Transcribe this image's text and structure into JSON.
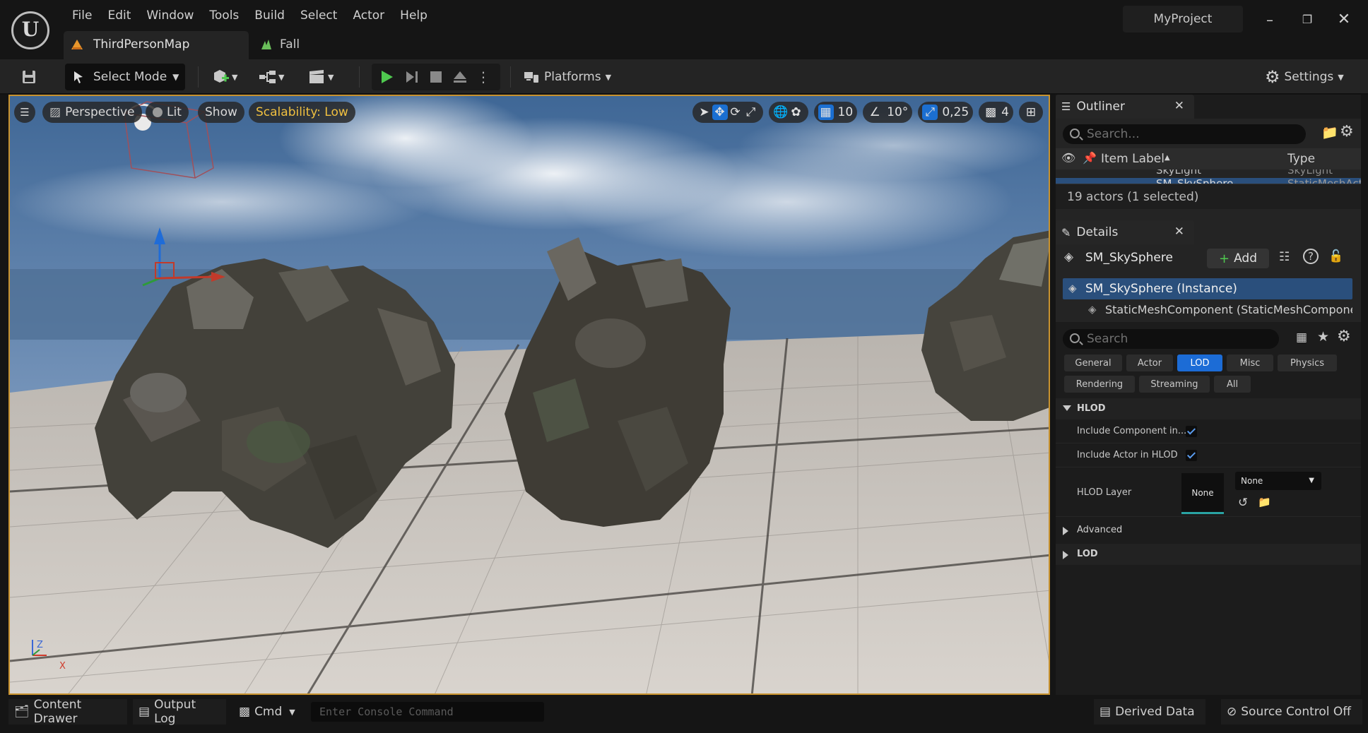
{
  "app": {
    "logo_letter": "U",
    "project_name": "MyProject",
    "menu": [
      "File",
      "Edit",
      "Window",
      "Tools",
      "Build",
      "Select",
      "Actor",
      "Help"
    ],
    "tabs": [
      {
        "label": "ThirdPersonMap",
        "icon": "level-icon",
        "active": true
      },
      {
        "label": "Fall",
        "icon": "landscape-icon",
        "active": false
      }
    ],
    "window_controls": [
      "minimize",
      "restore",
      "close"
    ]
  },
  "toolbar": {
    "select_mode": "Select Mode",
    "platforms": "Platforms",
    "settings": "Settings"
  },
  "viewport": {
    "perspective": "Perspective",
    "lit": "Lit",
    "show": "Show",
    "scalability": "Scalability: Low",
    "grid_snap": "10",
    "rotation_snap": "10°",
    "scale_snap": "0,25",
    "camera_speed": "4",
    "axis_z": "Z",
    "axis_x": "X",
    "accent_color": "#c8922e",
    "scalability_color": "#f0c040"
  },
  "outliner": {
    "title": "Outliner",
    "search_placeholder": "Search...",
    "col_label": "Item Label",
    "col_type": "Type",
    "partial_row_label": "SkyLight",
    "partial_row_type": "SkyLight",
    "selected_row_label": "SM_SkySphere",
    "selected_row_type": "StaticMeshActor",
    "summary": "19 actors (1 selected)"
  },
  "details": {
    "title": "Details",
    "actor_name": "SM_SkySphere",
    "add_label": "Add",
    "components": [
      {
        "label": "SM_SkySphere (Instance)",
        "selected": true
      },
      {
        "label": "StaticMeshComponent (StaticMeshComponent)",
        "selected": false
      }
    ],
    "search_placeholder": "Search",
    "categories_row1": [
      "General",
      "Actor",
      "LOD",
      "Misc",
      "Physics"
    ],
    "categories_row2": [
      "Rendering",
      "Streaming",
      "All"
    ],
    "active_category": "LOD",
    "hlod_section": "HLOD",
    "include_component": "Include Component in...",
    "include_actor": "Include Actor in HLOD",
    "hlod_layer": "HLOD Layer",
    "hlod_layer_thumb": "None",
    "hlod_layer_value": "None",
    "advanced_section": "Advanced",
    "lod_section": "LOD"
  },
  "statusbar": {
    "content_drawer": "Content Drawer",
    "output_log": "Output Log",
    "cmd": "Cmd",
    "console_placeholder": "Enter Console Command",
    "derived_data": "Derived Data",
    "source_control": "Source Control Off"
  }
}
